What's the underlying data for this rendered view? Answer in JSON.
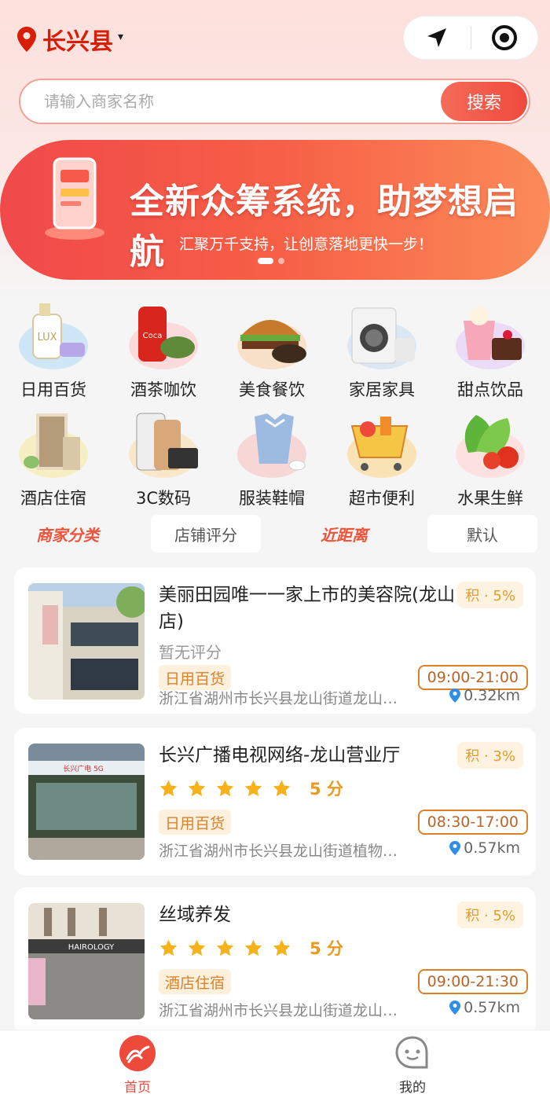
{
  "header": {
    "city": "长兴县",
    "caret": "▾"
  },
  "search": {
    "placeholder": "请输入商家名称",
    "button": "搜索"
  },
  "banner": {
    "title": "全新众筹系统，助梦想启航",
    "subtitle": "汇聚万千支持，让创意落地更快一步！",
    "slides": 2,
    "active_slide": 0
  },
  "categories": [
    {
      "label": "日用百货",
      "icon": "lotion-icon"
    },
    {
      "label": "酒茶咖饮",
      "icon": "drink-icon"
    },
    {
      "label": "美食餐饮",
      "icon": "burger-icon"
    },
    {
      "label": "家居家具",
      "icon": "washer-icon"
    },
    {
      "label": "甜点饮品",
      "icon": "dessert-icon"
    },
    {
      "label": "酒店住宿",
      "icon": "hotel-icon"
    },
    {
      "label": "3C数码",
      "icon": "phone-icon"
    },
    {
      "label": "服装鞋帽",
      "icon": "clothes-icon"
    },
    {
      "label": "超市便利",
      "icon": "cart-icon"
    },
    {
      "label": "水果生鲜",
      "icon": "vegetable-icon"
    }
  ],
  "filters": [
    {
      "label": "商家分类",
      "style": "hot"
    },
    {
      "label": "店铺评分",
      "style": "plain"
    },
    {
      "label": "近距离",
      "style": "hot"
    },
    {
      "label": "默认",
      "style": "plain"
    }
  ],
  "stores": [
    {
      "name": "美丽田园唯一一家上市的美容院(龙山店)",
      "points": "积 · 5%",
      "score_text": "暂无评分",
      "rating": null,
      "tag": "日用百货",
      "hours": "09:00-21:00",
      "address": "浙江省湖州市长兴县龙山街道龙山…",
      "distance": "0.32km"
    },
    {
      "name": "长兴广播电视网络-龙山营业厅",
      "points": "积 · 3%",
      "rating": 5,
      "rating_text": "5 分",
      "tag": "日用百货",
      "hours": "08:30-17:00",
      "address": "浙江省湖州市长兴县龙山街道植物…",
      "distance": "0.57km"
    },
    {
      "name": "丝域养发",
      "points": "积 · 5%",
      "rating": 5,
      "rating_text": "5 分",
      "tag": "酒店住宿",
      "hours": "09:00-21:30",
      "address": "浙江省湖州市长兴县龙山街道龙山…",
      "distance": "0.57km"
    }
  ],
  "tabbar": [
    {
      "label": "首页",
      "active": true
    },
    {
      "label": "我的",
      "active": false
    }
  ],
  "colors": {
    "brand": "#d81e06",
    "accent": "#ee4a3c",
    "star": "#f5b21b"
  }
}
